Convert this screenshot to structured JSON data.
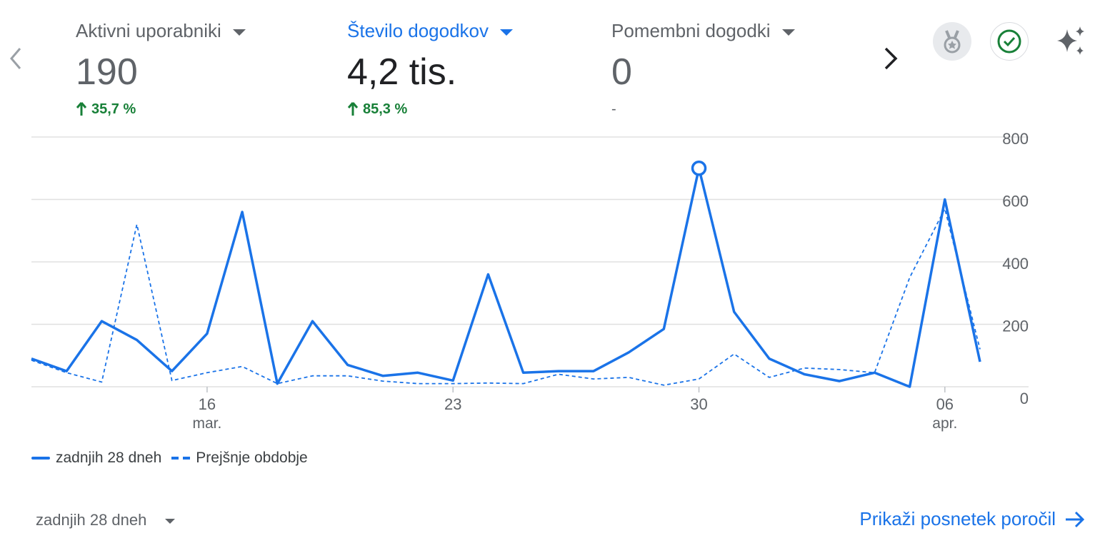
{
  "metrics": [
    {
      "label": "Aktivni uporabniki",
      "value": "190",
      "change": "35,7 %",
      "trend": "up"
    },
    {
      "label": "Število dogodkov",
      "value": "4,2 tis.",
      "change": "85,3 %",
      "trend": "up"
    },
    {
      "label": "Pomembni dogodki",
      "value": "0",
      "change": "-",
      "trend": "none"
    }
  ],
  "icons": {
    "prev": "chevron-left-icon",
    "next": "chevron-right-icon",
    "badge": "medal-badge-icon",
    "check": "check-circle-icon",
    "sparkle": "sparkle-icon"
  },
  "colors": {
    "accent": "#1a73e8",
    "positive": "#188038",
    "muted": "#5f6368",
    "grid": "#e0e0e0"
  },
  "chart_data": {
    "type": "line",
    "x_ticks": [
      {
        "index": 5,
        "label": "16",
        "sublabel": "mar."
      },
      {
        "index": 12,
        "label": "23",
        "sublabel": ""
      },
      {
        "index": 19,
        "label": "30",
        "sublabel": ""
      },
      {
        "index": 26,
        "label": "06",
        "sublabel": "apr."
      }
    ],
    "y_ticks": [
      0,
      200,
      400,
      600,
      800
    ],
    "ylim": [
      0,
      800
    ],
    "series": [
      {
        "name": "zadnjih 28 dneh",
        "style": "solid",
        "values": [
          90,
          50,
          210,
          150,
          50,
          170,
          560,
          10,
          210,
          70,
          35,
          45,
          20,
          360,
          45,
          50,
          50,
          110,
          185,
          700,
          240,
          90,
          40,
          18,
          45,
          0,
          600,
          80
        ]
      },
      {
        "name": "Prejšnje obdobje",
        "style": "dashed",
        "values": [
          85,
          45,
          15,
          520,
          20,
          45,
          65,
          10,
          35,
          35,
          18,
          10,
          10,
          12,
          10,
          40,
          25,
          30,
          5,
          25,
          105,
          30,
          60,
          55,
          45,
          350,
          570,
          120
        ]
      }
    ],
    "highlight_index": 19,
    "legend": "bottom-left"
  },
  "footer": {
    "period_label": "zadnjih 28 dneh",
    "report_link": "Prikaži posnetek poročil"
  }
}
